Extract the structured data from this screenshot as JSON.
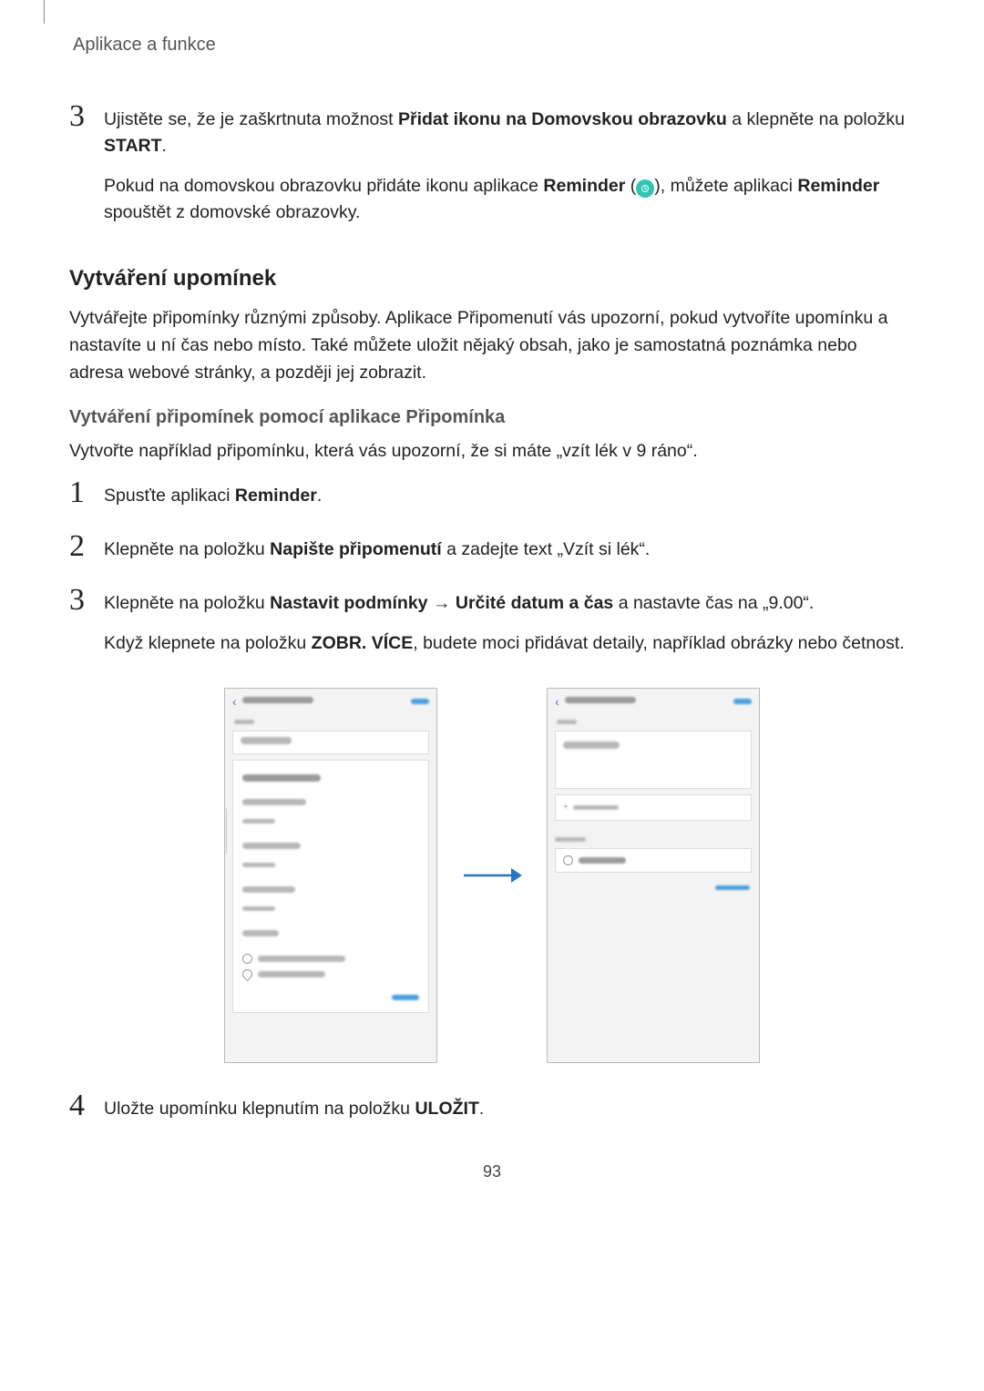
{
  "header": {
    "title": "Aplikace a funkce"
  },
  "step3_top": {
    "num": "3",
    "p1_a": "Ujistěte se, že je zaškrtnuta možnost ",
    "p1_b": "Přidat ikonu na Domovskou obrazovku",
    "p1_c": " a klepněte na položku ",
    "p1_d": "START",
    "p1_e": ".",
    "p2_a": "Pokud na domovskou obrazovku přidáte ikonu aplikace ",
    "p2_b": "Reminder",
    "p2_c": " (",
    "p2_d": "), můžete aplikaci ",
    "p2_e": "Reminder",
    "p2_f": " spouštět z domovské obrazovky."
  },
  "section1": {
    "h2": "Vytváření upomínek",
    "p": "Vytvářejte připomínky různými způsoby. Aplikace Připomenutí vás upozorní, pokud vytvoříte upomínku a nastavíte u ní čas nebo místo. Také můžete uložit nějaký obsah, jako je samostatná poznámka nebo adresa webové stránky, a později jej zobrazit.",
    "h3": "Vytváření připomínek pomocí aplikace Připomínka",
    "p2": "Vytvořte například připomínku, která vás upozorní, že si máte „vzít lék v 9 ráno“."
  },
  "steps": {
    "s1": {
      "num": "1",
      "a": "Spusťte aplikaci ",
      "b": "Reminder",
      "c": "."
    },
    "s2": {
      "num": "2",
      "a": "Klepněte na položku ",
      "b": "Napište připomenutí",
      "c": " a zadejte text „Vzít si lék“."
    },
    "s3": {
      "num": "3",
      "a": "Klepněte na položku ",
      "b": "Nastavit podmínky",
      "arrow": " → ",
      "c": "Určité datum a čas",
      "d": " a nastavte čas na „9.00“.",
      "p2_a": "Když klepnete na položku ",
      "p2_b": "ZOBR. VÍCE",
      "p2_c": ", budete moci přidávat detaily, například obrázky nebo četnost."
    },
    "s4": {
      "num": "4",
      "a": "Uložte upomínku klepnutím na položku ",
      "b": "ULOŽIT",
      "c": "."
    }
  },
  "page_number": "93"
}
